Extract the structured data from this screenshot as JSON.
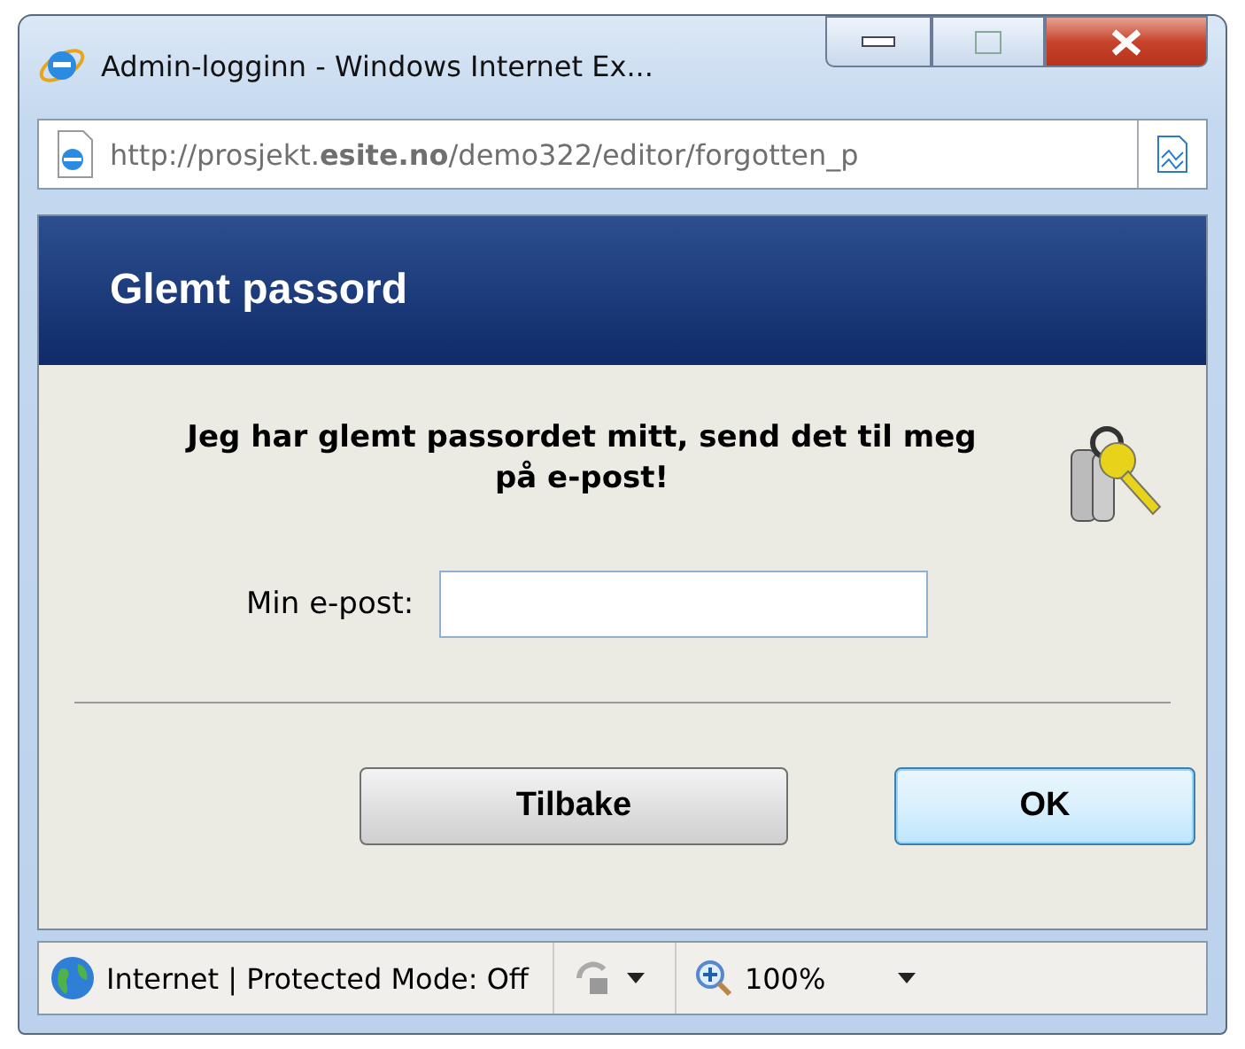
{
  "window": {
    "title": "Admin-logginn - Windows Internet Ex..."
  },
  "address_bar": {
    "url": "http://prosjekt.**esite.no**/demo322/editor/forgotten_p"
  },
  "header": {
    "title": "Glemt passord"
  },
  "form": {
    "message": "Jeg har glemt passordet mitt, send det til meg på e-post!",
    "email_label": "Min e-post:"
  },
  "buttons": [
    {
      "label": "Tilbake",
      "kind": "back",
      "focused": false
    },
    {
      "label": "OK",
      "kind": "ok",
      "focused": true
    }
  ],
  "status_bar": {
    "zone": "Internet | Protected Mode: Off",
    "zoom": "100%"
  }
}
